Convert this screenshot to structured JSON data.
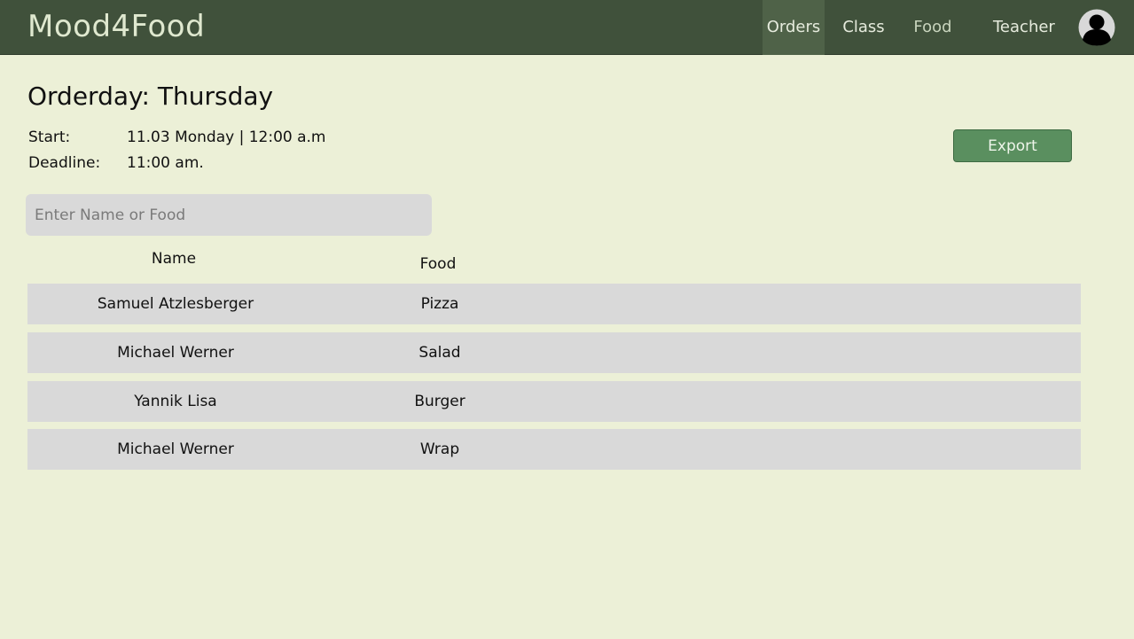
{
  "app": {
    "brand": "Mood4Food"
  },
  "nav": {
    "items": [
      {
        "label": "Orders"
      },
      {
        "label": "Class"
      },
      {
        "label": "Food"
      }
    ],
    "user_label": "Teacher",
    "avatar_icon": "user-avatar-icon"
  },
  "page": {
    "title": "Orderday: Thursday",
    "start_label": "Start:",
    "start_value": "11.03 Monday | 12:00 a.m",
    "deadline_label": "Deadline:",
    "deadline_value": "11:00 am.",
    "export_label": "Export"
  },
  "search": {
    "placeholder": "Enter Name or Food",
    "value": ""
  },
  "table": {
    "columns": [
      "Name",
      "Food"
    ],
    "rows": [
      {
        "name": "Samuel Atzlesberger",
        "food": "Pizza"
      },
      {
        "name": "Michael Werner",
        "food": "Salad"
      },
      {
        "name": "Yannik Lisa",
        "food": "Burger"
      },
      {
        "name": "Michael Werner",
        "food": "Wrap"
      }
    ]
  },
  "colors": {
    "navbar": "#40513b",
    "background": "#ecf0d7",
    "row": "#d9d9d9",
    "export_button": "#5a8f5f"
  }
}
